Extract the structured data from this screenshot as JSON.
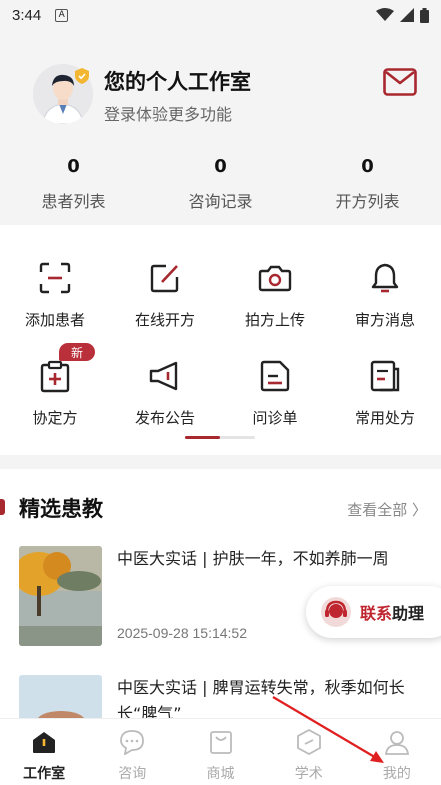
{
  "status_bar": {
    "time": "3:44",
    "notice_glyph": "A"
  },
  "profile": {
    "title": "您的个人工作室",
    "subtitle": "登录体验更多功能",
    "stats": [
      {
        "value": "0",
        "label": "患者列表"
      },
      {
        "value": "0",
        "label": "咨询记录"
      },
      {
        "value": "0",
        "label": "开方列表"
      }
    ]
  },
  "grid": {
    "items": [
      {
        "label": "添加患者",
        "icon": "scan-icon"
      },
      {
        "label": "在线开方",
        "icon": "edit-icon"
      },
      {
        "label": "拍方上传",
        "icon": "camera-icon"
      },
      {
        "label": "审方消息",
        "icon": "bell-icon"
      },
      {
        "label": "协定方",
        "icon": "clipboard-plus-icon"
      },
      {
        "label": "发布公告",
        "icon": "megaphone-icon"
      },
      {
        "label": "问诊单",
        "icon": "form-icon"
      },
      {
        "label": "常用处方",
        "icon": "prescription-icon"
      }
    ],
    "new_badge": "新"
  },
  "featured": {
    "title": "精选患教",
    "see_all": "查看全部 〉",
    "articles": [
      {
        "title": "中医大实话 | 护肤一年，不如养肺一周",
        "time": "2025-09-28 15:14:52"
      },
      {
        "title": "中医大实话 | 脾胃运转失常，秋季如何长长“脾气”"
      }
    ]
  },
  "contact": {
    "part1": "联系",
    "part2": "助理"
  },
  "tabs": [
    {
      "label": "工作室",
      "icon": "home-icon",
      "active": true
    },
    {
      "label": "咨询",
      "icon": "chat-icon",
      "active": false
    },
    {
      "label": "商城",
      "icon": "shop-icon",
      "active": false
    },
    {
      "label": "学术",
      "icon": "academic-icon",
      "active": false
    },
    {
      "label": "我的",
      "icon": "user-icon",
      "active": false
    }
  ],
  "colors": {
    "accent": "#a8282f",
    "badge": "#b9303a",
    "annotation_arrow": "#e02020"
  }
}
